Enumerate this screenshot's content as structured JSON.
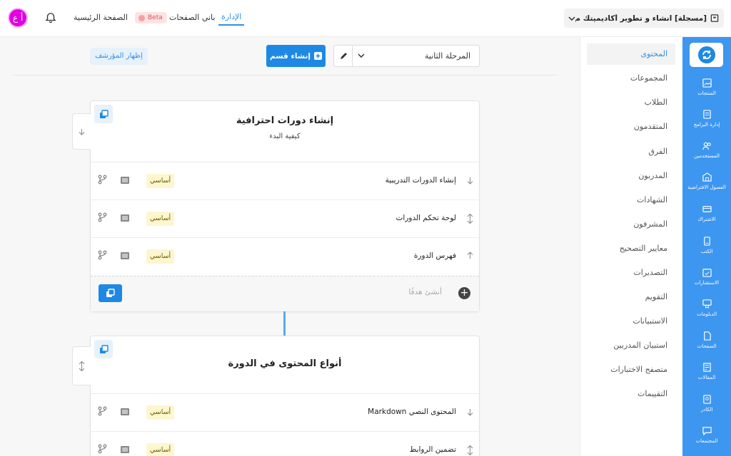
{
  "topbar": {
    "avatar_initials": "أ ع",
    "home_label": "الصفحة الرئيسية",
    "beta_label": "Beta",
    "page_builder_label": "باني الصفحات",
    "admin_label": "الإدارة",
    "course_title": "[مسجلة] انشاء و تطوير أكاديميتك مع زامن"
  },
  "sidebar": {
    "items": [
      {
        "label": "المنتجات",
        "icon": "image-icon"
      },
      {
        "label": "إدارة البرامج",
        "icon": "program-icon"
      },
      {
        "label": "المستخدمين",
        "icon": "users-icon"
      },
      {
        "label": "الفصول الافتراضية",
        "icon": "building-icon"
      },
      {
        "label": "الاشتراك",
        "icon": "card-icon"
      },
      {
        "label": "الكتب",
        "icon": "book-icon"
      },
      {
        "label": "الاستشارات",
        "icon": "calendar-icon"
      },
      {
        "label": "الدبلومات",
        "icon": "diploma-icon"
      },
      {
        "label": "الصفحات",
        "icon": "pages-icon"
      },
      {
        "label": "المقالات",
        "icon": "article-icon"
      },
      {
        "label": "الكادر",
        "icon": "staff-icon"
      },
      {
        "label": "المجتمعات",
        "icon": "chat-icon"
      }
    ]
  },
  "content_nav": {
    "items": [
      "المحتوى",
      "المجموعات",
      "الطلاب",
      "المتقدمون",
      "الفرق",
      "المدربون",
      "الشهادات",
      "المشرفون",
      "معايير التصحيح",
      "التصديرات",
      "التقويم",
      "الاستبيانات",
      "استبيان المدربين",
      "متصفح الاختبارات",
      "التقييمات"
    ],
    "active_index": 0
  },
  "toolbar": {
    "stage_value": "المرحلة الثانية",
    "create_section_label": "إنشاء قسم",
    "show_archive_label": "إظهار المؤرشف"
  },
  "sections": [
    {
      "title": "إنشاء دورات احترافية",
      "subtitle": "كيفية البدء",
      "lessons": [
        {
          "label": "إنشاء الدورات التدريبية",
          "badge": "أساسي",
          "arrow": "down"
        },
        {
          "label": "لوحة تحكم الدورات",
          "badge": "أساسي",
          "arrow": "updown"
        },
        {
          "label": "فهرس الدورة",
          "badge": "أساسي",
          "arrow": "up"
        }
      ],
      "add_placeholder": "أنشئ هدفًا"
    },
    {
      "title": "أنواع المحتوى في الدورة",
      "subtitle": "",
      "lessons": [
        {
          "label": "المحتوى النصي Markdown",
          "badge": "أساسي",
          "arrow": "down"
        },
        {
          "label": "تضمين الروابط",
          "badge": "أساسي",
          "arrow": "updown"
        }
      ]
    }
  ],
  "colors": {
    "primary": "#1e88e5",
    "sidebar": "#3d96f0",
    "badge_bg": "#fdf6cf",
    "avatar": "#e100e1"
  }
}
